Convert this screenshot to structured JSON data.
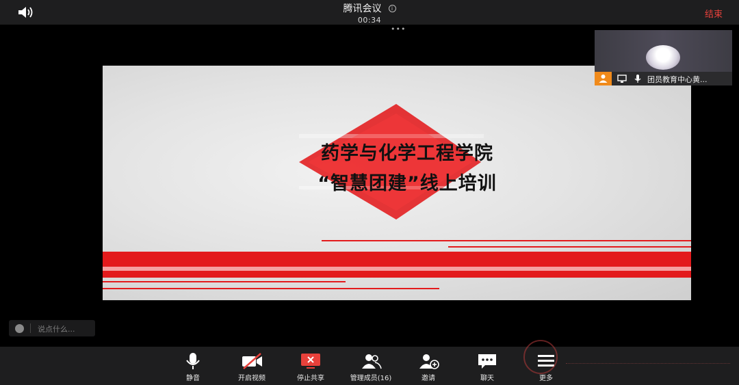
{
  "header": {
    "title": "腾讯会议",
    "timer": "00:34",
    "end_label": "结束"
  },
  "slide": {
    "line1": "药学与化学工程学院",
    "line2": "“智慧团建”线上培训"
  },
  "participant": {
    "name": "团员教育中心黄..."
  },
  "chat": {
    "placeholder": "说点什么..."
  },
  "toolbar": {
    "items": [
      {
        "label": "静音",
        "icon": "microphone-icon"
      },
      {
        "label": "开启视频",
        "icon": "video-off-icon"
      },
      {
        "label": "停止共享",
        "icon": "stop-share-icon"
      },
      {
        "label": "管理成员(16)",
        "icon": "members-icon"
      },
      {
        "label": "邀请",
        "icon": "invite-icon"
      },
      {
        "label": "聊天",
        "icon": "chat-icon"
      },
      {
        "label": "更多",
        "icon": "more-icon"
      }
    ]
  },
  "colors": {
    "accent_red": "#e8413b",
    "slide_red": "#e31a1c",
    "host_orange": "#f08a1b"
  }
}
